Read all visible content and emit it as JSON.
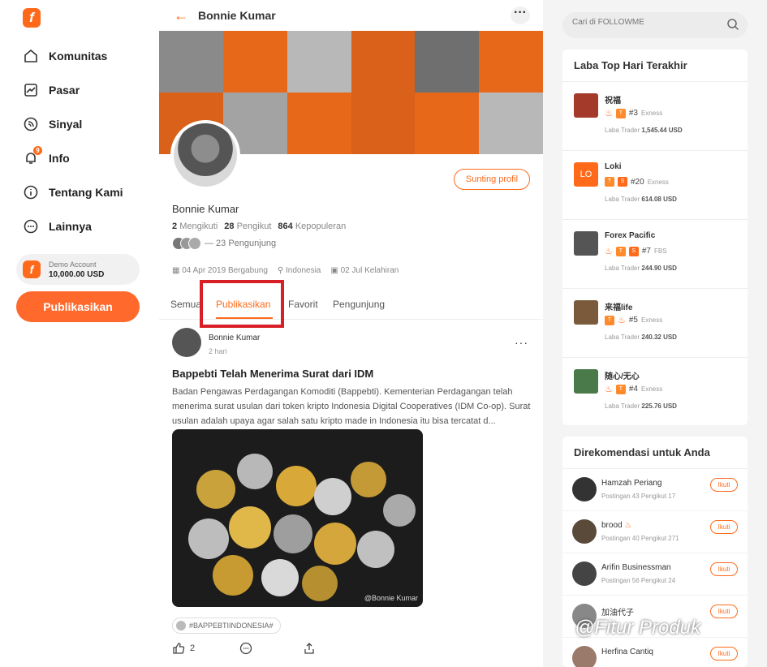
{
  "nav": {
    "logo": "f",
    "items": [
      {
        "label": "Komunitas",
        "icon": "home-icon"
      },
      {
        "label": "Pasar",
        "icon": "chart-icon"
      },
      {
        "label": "Sinyal",
        "icon": "signal-icon"
      },
      {
        "label": "Info",
        "icon": "bell-icon",
        "badge": "9"
      },
      {
        "label": "Tentang Kami",
        "icon": "info-icon"
      },
      {
        "label": "Lainnya",
        "icon": "more-icon"
      }
    ],
    "demo_label": "Demo Account",
    "demo_value": "10,000.00 USD",
    "publish_label": "Publikasikan"
  },
  "profile": {
    "topbar_name": "Bonnie Kumar",
    "edit_label": "Sunting profil",
    "name": "Bonnie Kumar",
    "following": "2",
    "following_label": "Mengikuti",
    "followers": "28",
    "followers_label": "Pengikut",
    "popularity": "864",
    "popularity_label": "Kepopuleran",
    "visitors_text": "— 23 Pengunjung",
    "joined": "04 Apr 2019 Bergabung",
    "location": "Indonesia",
    "birthday": "02 Jul Kelahiran",
    "tabs": [
      "Semua",
      "Publikasikan",
      "Favorit",
      "Pengunjung"
    ]
  },
  "post": {
    "author": "Bonnie Kumar",
    "time": "2 hari",
    "title": "Bappebti Telah Menerima Surat dari IDM",
    "body": "Badan Pengawas Perdagangan Komoditi (Bappebti). Kementerian Perdagangan telah menerima surat usulan dari token kripto Indonesia Digital Cooperatives (IDM Co-op). Surat usulan adalah upaya agar salah satu kripto made in Indonesia itu bisa tercatat d...",
    "image_caption": "@Bonnie Kumar",
    "tag": "#BAPPEBTIINDONESIA#",
    "likes": "2"
  },
  "search": {
    "placeholder": "Cari di FOLLOWME"
  },
  "top_traders": {
    "title": "Laba Top Hari Terakhir",
    "items": [
      {
        "name": "祝福",
        "rank": "#3",
        "broker": "Exness",
        "profit_label": "Laba Trader",
        "profit": "1,545.44 USD",
        "color": "#a33a2a"
      },
      {
        "name": "Loki",
        "rank": "#20",
        "broker": "Exness",
        "profit_label": "Laba Trader",
        "profit": "614.08 USD",
        "color": "#ff6a1a",
        "initials": "LO"
      },
      {
        "name": "Forex Pacific",
        "rank": "#7",
        "broker": "FBS",
        "profit_label": "Laba Trader",
        "profit": "244.90 USD",
        "color": "#555555"
      },
      {
        "name": "来福life",
        "rank": "#5",
        "broker": "Exness",
        "profit_label": "Laba Trader",
        "profit": "240.32 USD",
        "color": "#7a5a3a"
      },
      {
        "name": "随心/无心",
        "rank": "#4",
        "broker": "Exness",
        "profit_label": "Laba Trader",
        "profit": "225.76 USD",
        "color": "#4a7a4a"
      }
    ]
  },
  "recommend": {
    "title": "Direkomendasi untuk Anda",
    "follow_label": "Ikuti",
    "items": [
      {
        "name": "Hamzah Periang",
        "meta": "Postingan 43   Pengikut 17"
      },
      {
        "name": "brood",
        "meta": "Postingan 40   Pengikut 271"
      },
      {
        "name": "Arifin Businessman",
        "meta": "Postingan 56   Pengikut 24"
      },
      {
        "name": "加油代子",
        "meta": ""
      },
      {
        "name": "Herfina Cantiq",
        "meta": ""
      }
    ]
  },
  "watermark": "@Fitur Produk",
  "colors": {
    "accent": "#ff6a1a",
    "highlight_box": "#d81f26"
  }
}
